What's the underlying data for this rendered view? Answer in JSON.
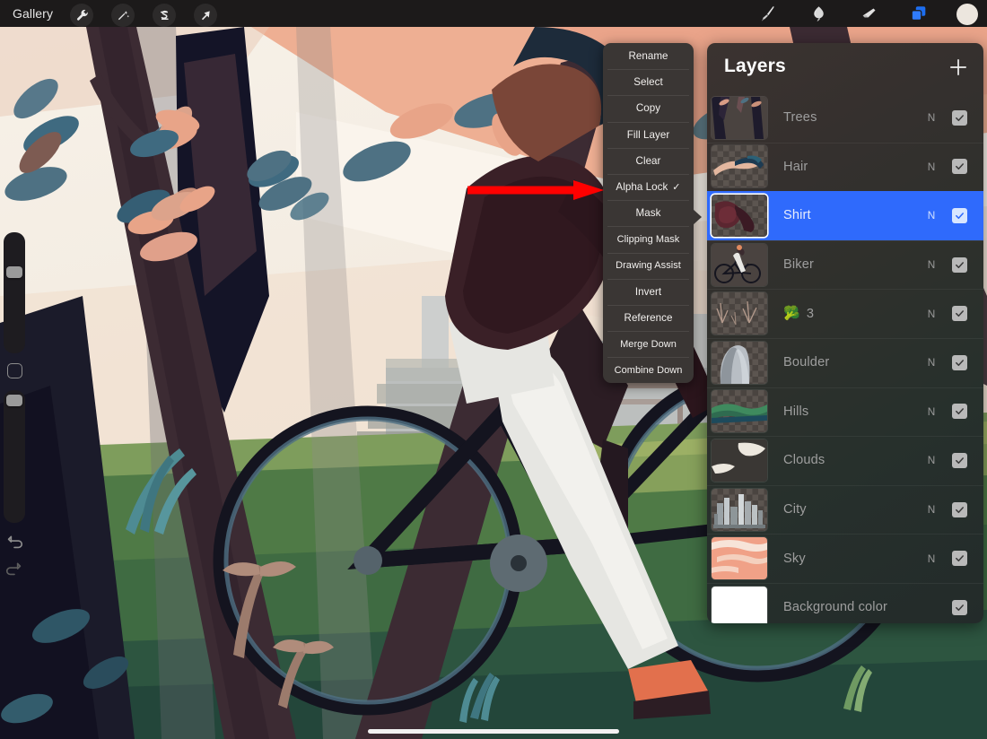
{
  "app": {
    "name": "Procreate",
    "gallery_label": "Gallery"
  },
  "toolbar": {
    "left_tools": [
      {
        "name": "wrench-icon",
        "label": "Actions"
      },
      {
        "name": "magic-wand-icon",
        "label": "Adjustments"
      },
      {
        "name": "selection-icon",
        "label": "Selection"
      },
      {
        "name": "transform-arrow-icon",
        "label": "Transform"
      }
    ],
    "right_tools": [
      {
        "name": "paintbrush-icon",
        "label": "Paint",
        "active": false
      },
      {
        "name": "smudge-icon",
        "label": "Smudge",
        "active": false
      },
      {
        "name": "eraser-icon",
        "label": "Erase",
        "active": false
      },
      {
        "name": "layers-icon",
        "label": "Layers",
        "active": true
      }
    ],
    "color_swatch": "#ece6de",
    "active_accent": "#1d6ef0"
  },
  "sidebar": {
    "brush_size_label": "Brush size",
    "brush_opacity_label": "Brush opacity",
    "modify_label": "Modify",
    "undo_label": "Undo",
    "redo_label": "Redo"
  },
  "context_menu": {
    "items": [
      {
        "label": "Rename",
        "checked": false
      },
      {
        "label": "Select",
        "checked": false
      },
      {
        "label": "Copy",
        "checked": false
      },
      {
        "label": "Fill Layer",
        "checked": false
      },
      {
        "label": "Clear",
        "checked": false
      },
      {
        "label": "Alpha Lock",
        "checked": true
      },
      {
        "label": "Mask",
        "checked": false
      },
      {
        "label": "Clipping Mask",
        "checked": false
      },
      {
        "label": "Drawing Assist",
        "checked": false
      },
      {
        "label": "Invert",
        "checked": false
      },
      {
        "label": "Reference",
        "checked": false
      },
      {
        "label": "Merge Down",
        "checked": false
      },
      {
        "label": "Combine Down",
        "checked": false
      }
    ],
    "check_glyph": "✓"
  },
  "annotation": {
    "type": "arrow",
    "color": "#ff0000",
    "points_to": "Alpha Lock"
  },
  "layers_panel": {
    "title": "Layers",
    "add_button_label": "+",
    "selected_layer": "Shirt",
    "selection_color": "#2f6afc",
    "layers": [
      {
        "name": "Trees",
        "blend": "N",
        "visible": true,
        "thumb": "trees",
        "transparent": false,
        "group_count": null,
        "emoji": null
      },
      {
        "name": "Hair",
        "blend": "N",
        "visible": true,
        "thumb": "hair",
        "transparent": true,
        "group_count": null,
        "emoji": null
      },
      {
        "name": "Shirt",
        "blend": "N",
        "visible": true,
        "thumb": "shirt",
        "transparent": true,
        "group_count": null,
        "emoji": null
      },
      {
        "name": "Biker",
        "blend": "N",
        "visible": true,
        "thumb": "biker",
        "transparent": false,
        "group_count": null,
        "emoji": null
      },
      {
        "name": "3",
        "blend": "N",
        "visible": true,
        "thumb": "branches",
        "transparent": true,
        "group_count": "3",
        "emoji": "🥦"
      },
      {
        "name": "Boulder",
        "blend": "N",
        "visible": true,
        "thumb": "boulder",
        "transparent": true,
        "group_count": null,
        "emoji": null
      },
      {
        "name": "Hills",
        "blend": "N",
        "visible": true,
        "thumb": "hills",
        "transparent": true,
        "group_count": null,
        "emoji": null
      },
      {
        "name": "Clouds",
        "blend": "N",
        "visible": true,
        "thumb": "clouds",
        "transparent": false,
        "group_count": null,
        "emoji": null
      },
      {
        "name": "City",
        "blend": "N",
        "visible": true,
        "thumb": "city",
        "transparent": true,
        "group_count": null,
        "emoji": null
      },
      {
        "name": "Sky",
        "blend": "N",
        "visible": true,
        "thumb": "sky",
        "transparent": false,
        "group_count": null,
        "emoji": null
      },
      {
        "name": "Background color",
        "blend": "",
        "visible": true,
        "thumb": "background",
        "transparent": false,
        "group_count": null,
        "emoji": null
      }
    ]
  },
  "artwork": {
    "description": "Flat-style illustration of a cyclist riding past trees with a city skyline",
    "palette": {
      "sky_cream": "#f6efe6",
      "sky_peach": "#eda98c",
      "tree_dark": "#3c2b33",
      "tree_navy": "#141427",
      "leaf_teal": "#4e7183",
      "leaf_peach": "#e8a488",
      "grass_green": "#4f7a46",
      "grass_light": "#7a9a57",
      "shirt_maroon": "#3a2027",
      "jeans_white": "#e6e6e2",
      "shoe_coral": "#e2704d",
      "bike_black": "#14141f",
      "city_grey": "#9aa2a6"
    }
  },
  "home_indicator": {
    "visible": true
  }
}
